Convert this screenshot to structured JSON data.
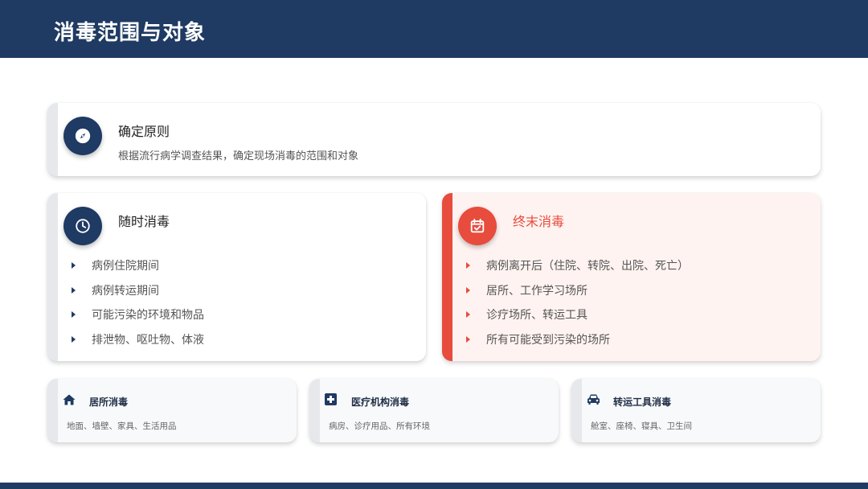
{
  "header": {
    "title": "消毒范围与对象"
  },
  "principle": {
    "icon": "compass-icon",
    "title": "确定原则",
    "desc": "根据流行病学调查结果，确定现场消毒的范围和对象"
  },
  "concurrent": {
    "icon": "clock-icon",
    "title": "随时消毒",
    "items": [
      "病例住院期间",
      "病例转运期间",
      "可能污染的环境和物品",
      "排泄物、呕吐物、体液"
    ]
  },
  "terminal": {
    "icon": "calendar-check-icon",
    "title": "终末消毒",
    "items": [
      "病例离开后（住院、转院、出院、死亡）",
      "居所、工作学习场所",
      "诊疗场所、转运工具",
      "所有可能受到污染的场所"
    ]
  },
  "bottom_cards": [
    {
      "icon": "home-icon",
      "title": "居所消毒",
      "desc": "地面、墙壁、家具、生活用品"
    },
    {
      "icon": "medical-cross-icon",
      "title": "医疗机构消毒",
      "desc": "病房、诊疗用品、所有环境"
    },
    {
      "icon": "car-icon",
      "title": "转运工具消毒",
      "desc": "舱室、座椅、寝具、卫生间"
    }
  ],
  "colors": {
    "primary": "#1f3a63",
    "accent": "#e74c3c",
    "terminal_bg": "#fff3f1"
  }
}
